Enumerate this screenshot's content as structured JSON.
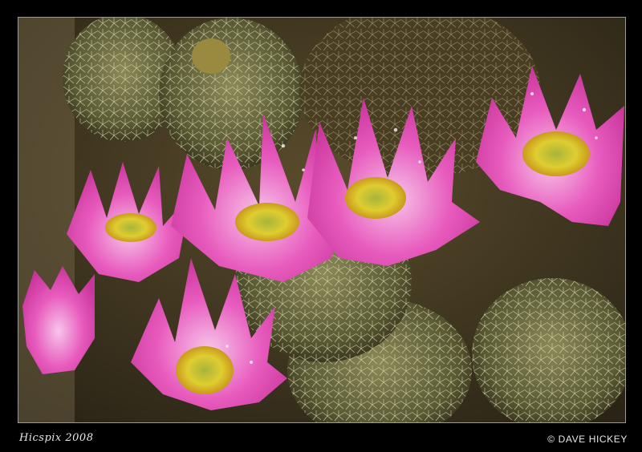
{
  "caption": {
    "signature": "Hicspix 2008",
    "copyright": "© DAVE HICKEY"
  },
  "scene": {
    "subject": "pink cactus flowers",
    "colors": {
      "petal_pink": "#e84fb8",
      "petal_light": "#f6b7e6",
      "center_yellow": "#d9c52a",
      "cactus_green": "#6c7040",
      "spine": "#d9d2b0",
      "background": "#4a3e26"
    }
  }
}
